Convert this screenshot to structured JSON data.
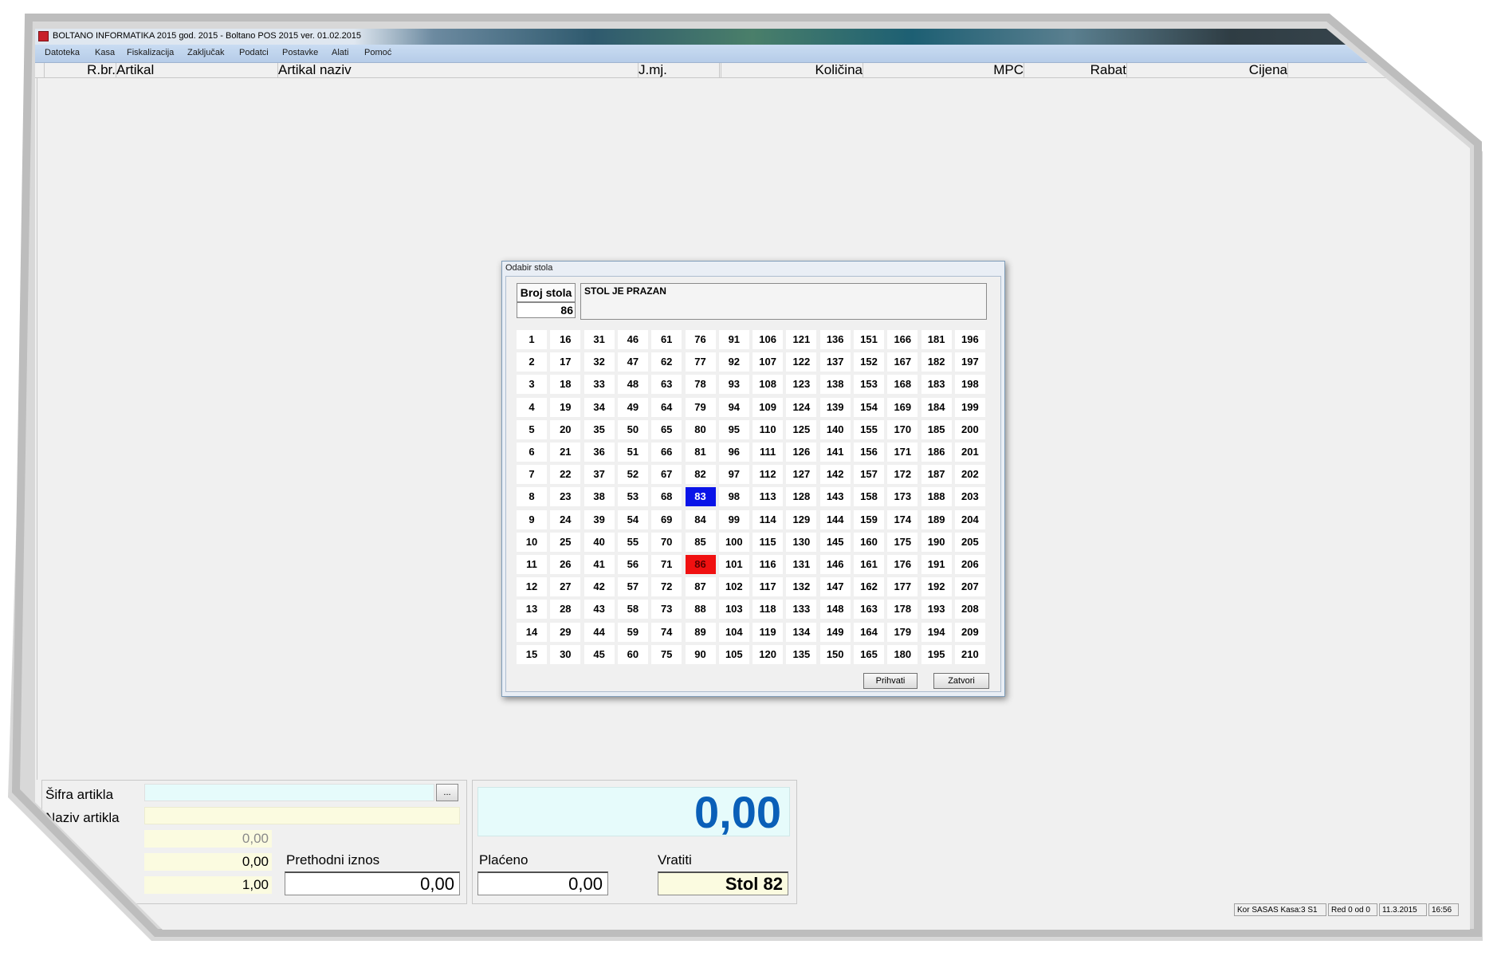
{
  "window": {
    "title": "BOLTANO INFORMATIKA 2015 god. 2015 - Boltano POS 2015 ver. 01.02.2015"
  },
  "menu": [
    "Datoteka",
    "Kasa",
    "Fiskalizacija",
    "Zaključak",
    "Podatci",
    "Postavke",
    "Alati",
    "Pomoć"
  ],
  "grid": {
    "columns": [
      "R.br.",
      "Artikal",
      "Artikal naziv",
      "J.mj.",
      "",
      "Količina",
      "MPC",
      "Rabat",
      "Cijena"
    ]
  },
  "dialog": {
    "title": "Odabir stola",
    "table_label": "Broj stola",
    "table_number": "86",
    "status": "STOL JE PRAZAN",
    "tables": [
      [
        1,
        16,
        31,
        46,
        61,
        76,
        91,
        106,
        121,
        136,
        151,
        166,
        181,
        196
      ],
      [
        2,
        17,
        32,
        47,
        62,
        77,
        92,
        107,
        122,
        137,
        152,
        167,
        182,
        197
      ],
      [
        3,
        18,
        33,
        48,
        63,
        78,
        93,
        108,
        123,
        138,
        153,
        168,
        183,
        198
      ],
      [
        4,
        19,
        34,
        49,
        64,
        79,
        94,
        109,
        124,
        139,
        154,
        169,
        184,
        199
      ],
      [
        5,
        20,
        35,
        50,
        65,
        80,
        95,
        110,
        125,
        140,
        155,
        170,
        185,
        200
      ],
      [
        6,
        21,
        36,
        51,
        66,
        81,
        96,
        111,
        126,
        141,
        156,
        171,
        186,
        201
      ],
      [
        7,
        22,
        37,
        52,
        67,
        82,
        97,
        112,
        127,
        142,
        157,
        172,
        187,
        202
      ],
      [
        8,
        23,
        38,
        53,
        68,
        83,
        98,
        113,
        128,
        143,
        158,
        173,
        188,
        203
      ],
      [
        9,
        24,
        39,
        54,
        69,
        84,
        99,
        114,
        129,
        144,
        159,
        174,
        189,
        204
      ],
      [
        10,
        25,
        40,
        55,
        70,
        85,
        100,
        115,
        130,
        145,
        160,
        175,
        190,
        205
      ],
      [
        11,
        26,
        41,
        56,
        71,
        86,
        101,
        116,
        131,
        146,
        161,
        176,
        191,
        206
      ],
      [
        12,
        27,
        42,
        57,
        72,
        87,
        102,
        117,
        132,
        147,
        162,
        177,
        192,
        207
      ],
      [
        13,
        28,
        43,
        58,
        73,
        88,
        103,
        118,
        133,
        148,
        163,
        178,
        193,
        208
      ],
      [
        14,
        29,
        44,
        59,
        74,
        89,
        104,
        119,
        134,
        149,
        164,
        179,
        194,
        209
      ],
      [
        15,
        30,
        45,
        60,
        75,
        90,
        105,
        120,
        135,
        150,
        165,
        180,
        195,
        210
      ]
    ],
    "occupied_blue": [
      83
    ],
    "occupied_red": [
      86
    ],
    "accept_label": "Prihvati",
    "close_label": "Zatvori"
  },
  "bottom": {
    "sifra_label": "Šifra artikla",
    "naziv_label": "Naziv artikla",
    "browse_label": "...",
    "val1": "0,00",
    "val2": "0,00",
    "val3": "1,00",
    "prethodni_label": "Prethodni iznos",
    "prethodni_value": "0,00",
    "total": "0,00",
    "placeno_label": "Plaćeno",
    "placeno_value": "0,00",
    "vratiti_label": "Vratiti",
    "vratiti_value": "Stol 82"
  },
  "statusbar": {
    "user": "Kor SASAS Kasa:3 S1",
    "row": "Red 0 od 0",
    "date": "11.3.2015",
    "time": "16:56"
  },
  "colors": {
    "total_text": "#0a5fb8",
    "field_yellow": "#fbfbe0",
    "field_cyan": "#e6fbfb"
  }
}
